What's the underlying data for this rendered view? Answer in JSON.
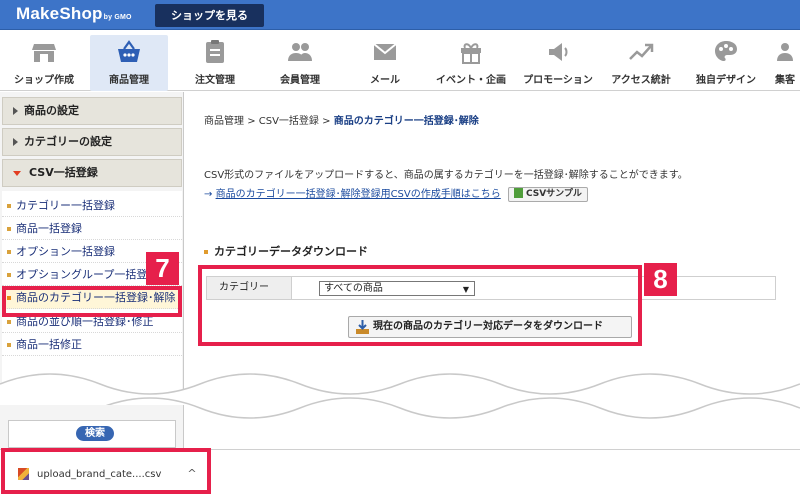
{
  "brand": {
    "logo": "MakeShop",
    "logo_sup": "by GMO",
    "shop_button": "ショップを見る"
  },
  "nav": {
    "items": [
      {
        "label": "ショップ作成",
        "icon": "store-icon"
      },
      {
        "label": "商品管理",
        "icon": "basket-icon",
        "active": true
      },
      {
        "label": "注文管理",
        "icon": "clipboard-icon"
      },
      {
        "label": "会員管理",
        "icon": "users-icon"
      },
      {
        "label": "メール",
        "icon": "mail-icon"
      },
      {
        "label": "イベント・企画",
        "icon": "gift-icon"
      },
      {
        "label": "プロモーション",
        "icon": "megaphone-icon"
      },
      {
        "label": "アクセス統計",
        "icon": "trend-icon"
      },
      {
        "label": "独自デザイン",
        "icon": "palette-icon"
      },
      {
        "label": "集客",
        "icon": "group-icon"
      }
    ]
  },
  "sidebar": {
    "sections": [
      {
        "label": "商品の設定",
        "expanded": false
      },
      {
        "label": "カテゴリーの設定",
        "expanded": false
      },
      {
        "label": "CSV一括登録",
        "expanded": true
      }
    ],
    "items": [
      {
        "label": "カテゴリー一括登録"
      },
      {
        "label": "商品一括登録"
      },
      {
        "label": "オプション一括登録"
      },
      {
        "label": "オプショングループ一括登録"
      },
      {
        "label": "商品のカテゴリー一括登録･解除",
        "active": true
      },
      {
        "label": "商品の並び順一括登録･修正"
      },
      {
        "label": "商品一括修正"
      }
    ],
    "search_button": "検索"
  },
  "breadcrumb": {
    "part1": "商品管理",
    "sep": ">",
    "part2": "CSV一括登録",
    "current": "商品のカテゴリー一括登録･解除"
  },
  "content": {
    "description": "CSV形式のファイルをアップロードすると、商品の属するカテゴリーを一括登録･解除することができます。",
    "link_arrow": "→",
    "link_text": "商品のカテゴリー一括登録･解除登録用CSVの作成手順はこちら",
    "csv_sample_button": "CSVサンプル",
    "section_title": "カテゴリーデータダウンロード",
    "category_label": "カテゴリー",
    "category_select_value": "すべての商品",
    "download_button": "現在の商品のカテゴリー対応データをダウンロード"
  },
  "annotations": {
    "badge_7": "7",
    "badge_8": "8"
  },
  "download_bar": {
    "filename": "upload_brand_cate....csv",
    "caret": "^"
  },
  "colors": {
    "brand_blue": "#3d74c8",
    "annotation_red": "#e6204b",
    "nav_active": "#dfe8f6"
  }
}
